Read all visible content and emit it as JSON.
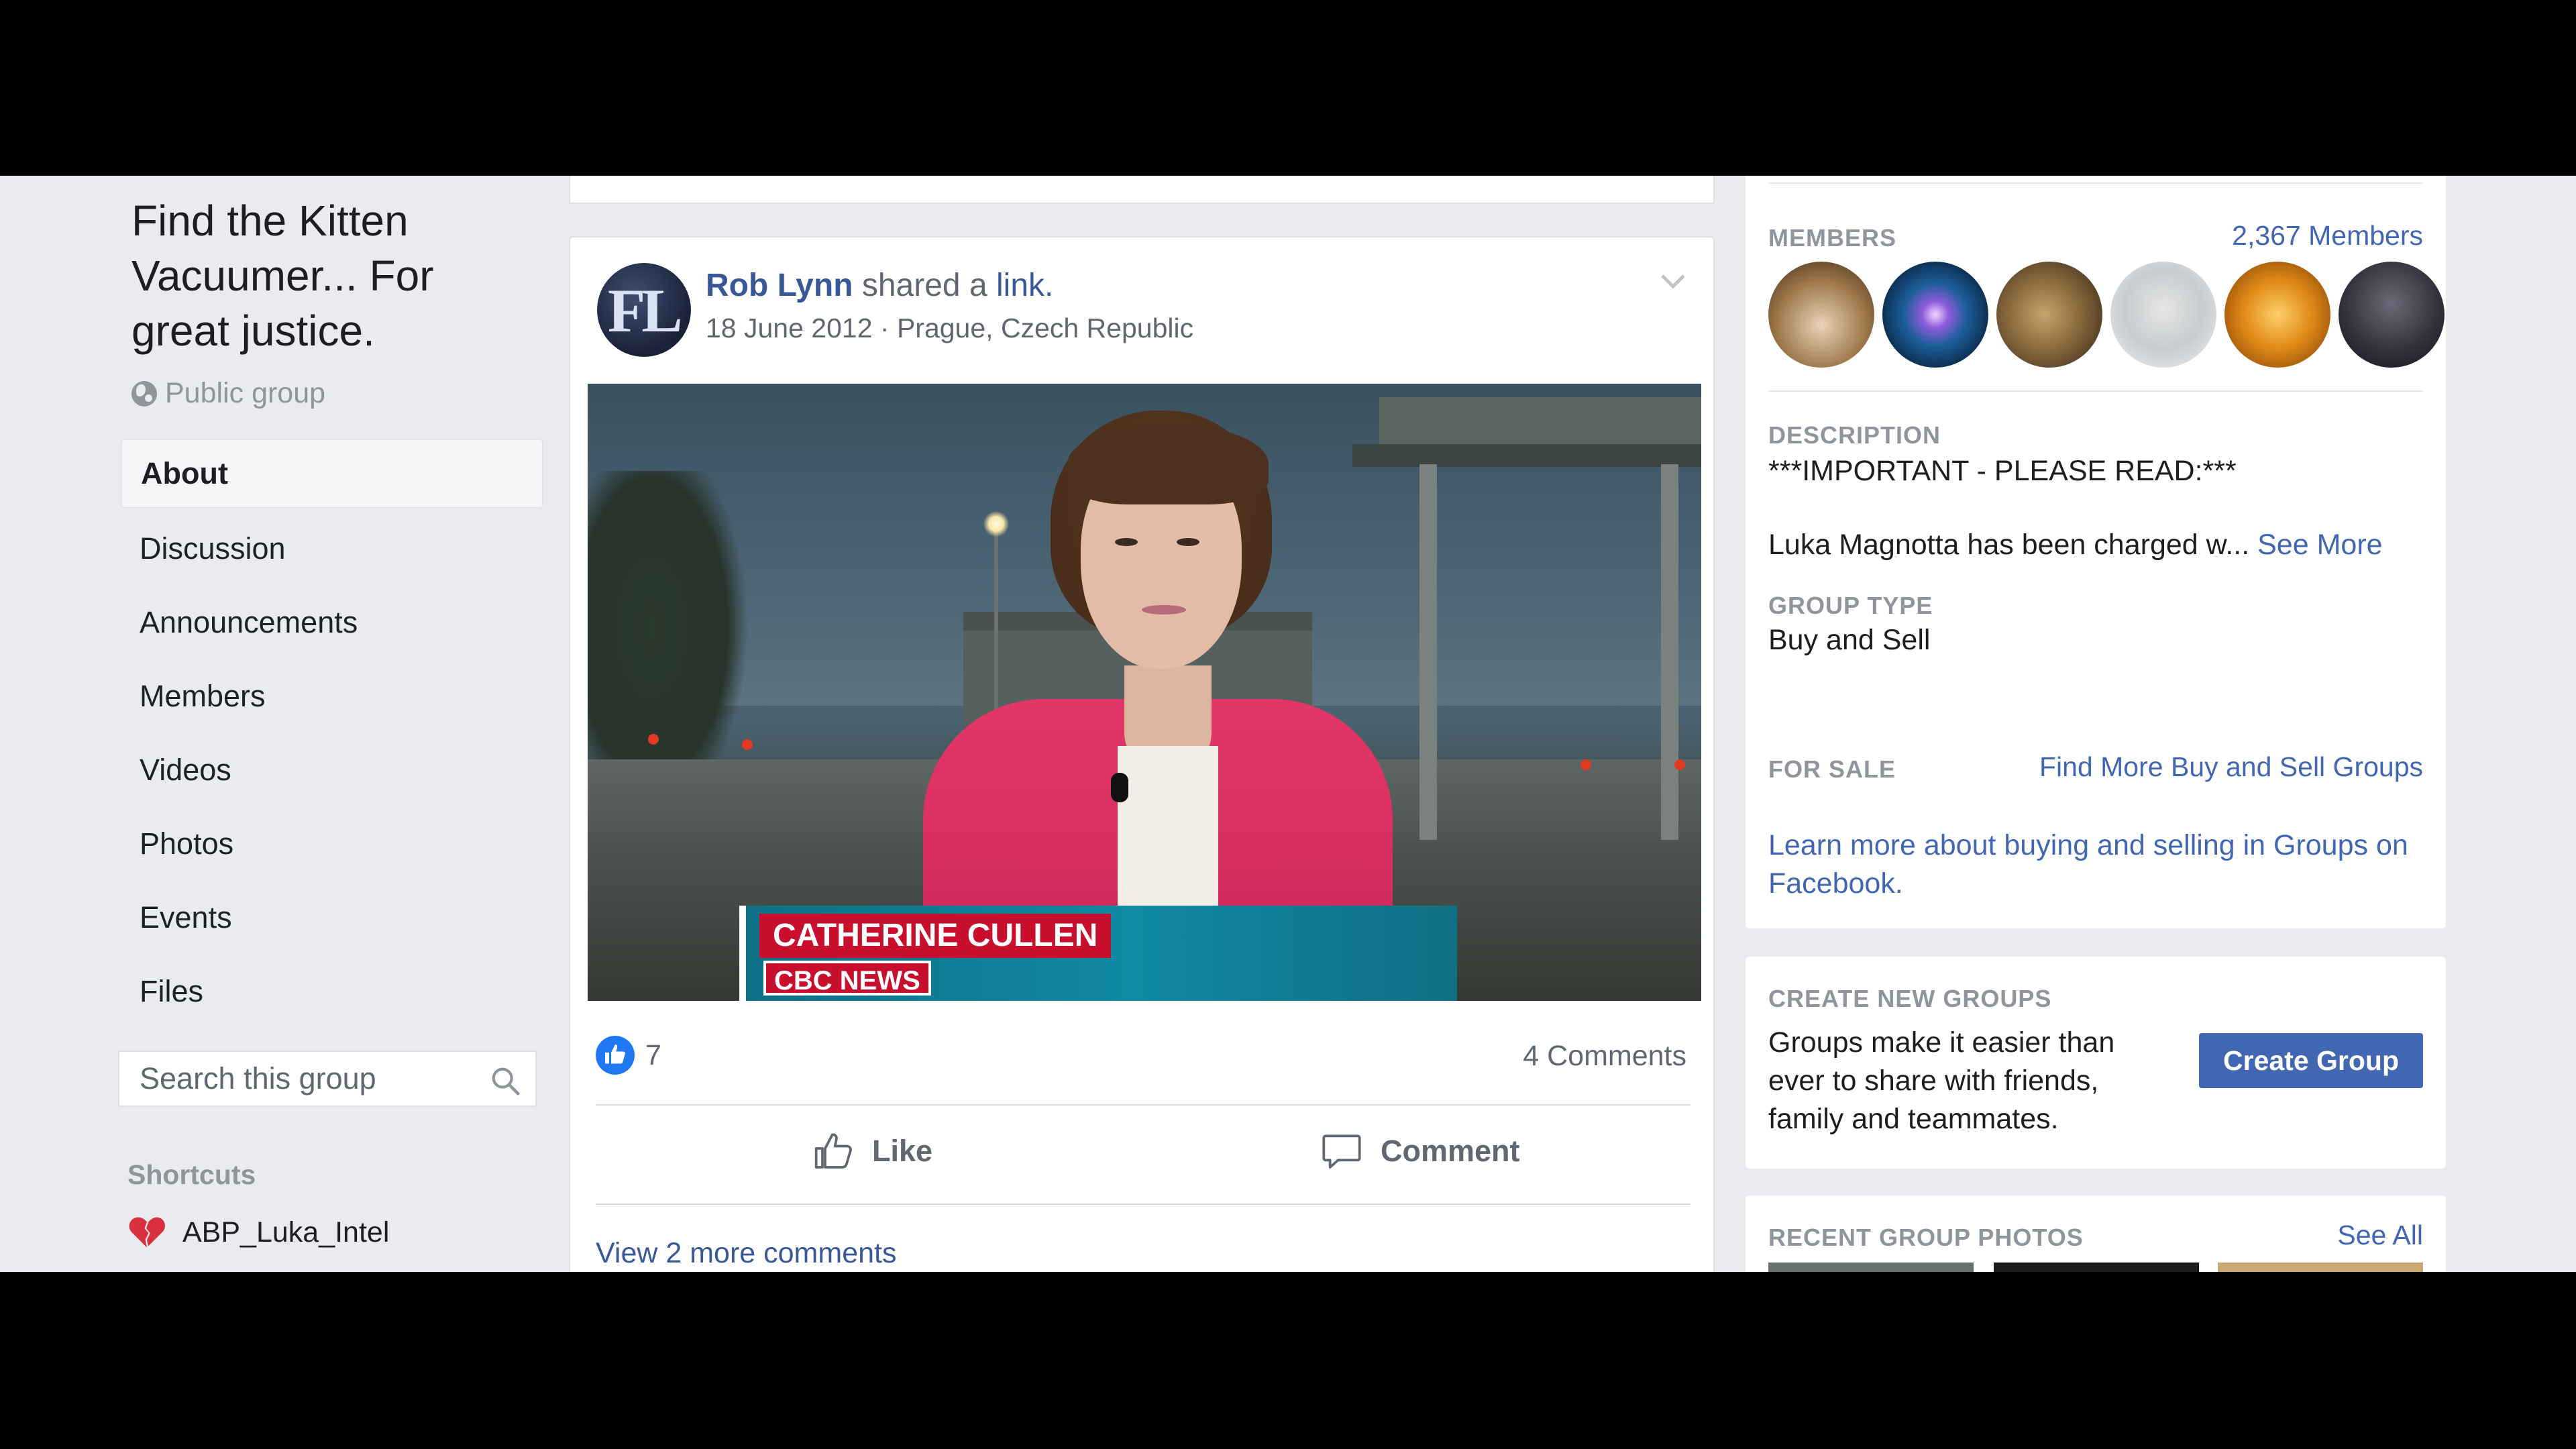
{
  "group": {
    "title": "Find the Kitten Vacuumer... For great justice.",
    "privacy": "Public group"
  },
  "nav": {
    "items": [
      "About",
      "Discussion",
      "Announcements",
      "Members",
      "Videos",
      "Photos",
      "Events",
      "Files"
    ],
    "active": "About"
  },
  "search": {
    "placeholder": "Search this group"
  },
  "shortcuts": {
    "heading": "Shortcuts",
    "items": [
      {
        "label": "ABP_Luka_Intel",
        "icon": "broken-heart-icon"
      }
    ]
  },
  "post": {
    "author": "Rob Lynn",
    "action_text": " shared a ",
    "link_word": "link.",
    "date": "18 June 2012",
    "separator": " · ",
    "location": "Prague, Czech Republic",
    "avatar_text": "FL",
    "video": {
      "name_tag": "CATHERINE CULLEN",
      "org_tag": "CBC NEWS"
    },
    "likes": "7",
    "comments_count": "4 Comments",
    "like_label": "Like",
    "comment_label": "Comment",
    "view_more": "View 2 more comments"
  },
  "sidebar": {
    "members_heading": "MEMBERS",
    "members_count": "2,367 Members",
    "description_heading": "DESCRIPTION",
    "description_line1": "***IMPORTANT - PLEASE READ:***",
    "description_line2": "Luka Magnotta has been charged w...",
    "see_more": "See More",
    "group_type_heading": "GROUP TYPE",
    "group_type": "Buy and Sell",
    "for_sale_heading": "FOR SALE",
    "find_more": "Find More Buy and Sell Groups",
    "learn_more": "Learn more about buying and selling in Groups on Facebook.",
    "create_heading": "CREATE NEW GROUPS",
    "create_text": "Groups make it easier than ever to share with friends, family and teammates.",
    "create_button": "Create Group",
    "photos_heading": "RECENT GROUP PHOTOS",
    "see_all": "See All"
  },
  "colors": {
    "link": "#385898",
    "button": "#4267b2",
    "background": "#e9ebee",
    "like_blue": "#2078f4",
    "news_red": "#c8102e"
  }
}
